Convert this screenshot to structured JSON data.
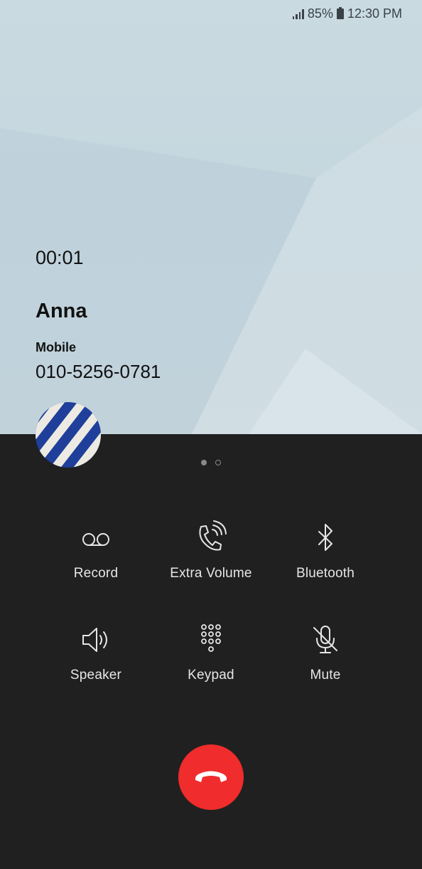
{
  "status_bar": {
    "battery": "85%",
    "time": "12:30 PM"
  },
  "call": {
    "duration": "00:01",
    "contact_name": "Anna",
    "number_label": "Mobile",
    "phone_number": "010-5256-0781"
  },
  "pager": {
    "pages": 2,
    "active": 0
  },
  "actions": {
    "record": {
      "label": "Record",
      "icon": "voicemail-record-icon"
    },
    "extra_volume": {
      "label": "Extra Volume",
      "icon": "phone-volume-icon"
    },
    "bluetooth": {
      "label": "Bluetooth",
      "icon": "bluetooth-icon"
    },
    "speaker": {
      "label": "Speaker",
      "icon": "speaker-icon"
    },
    "keypad": {
      "label": "Keypad",
      "icon": "keypad-icon"
    },
    "mute": {
      "label": "Mute",
      "icon": "mic-off-icon"
    }
  },
  "end_call": {
    "icon": "hang-up-icon",
    "color": "#f02c2c"
  },
  "colors": {
    "panel": "#202020",
    "icon": "#e6e6e6"
  }
}
